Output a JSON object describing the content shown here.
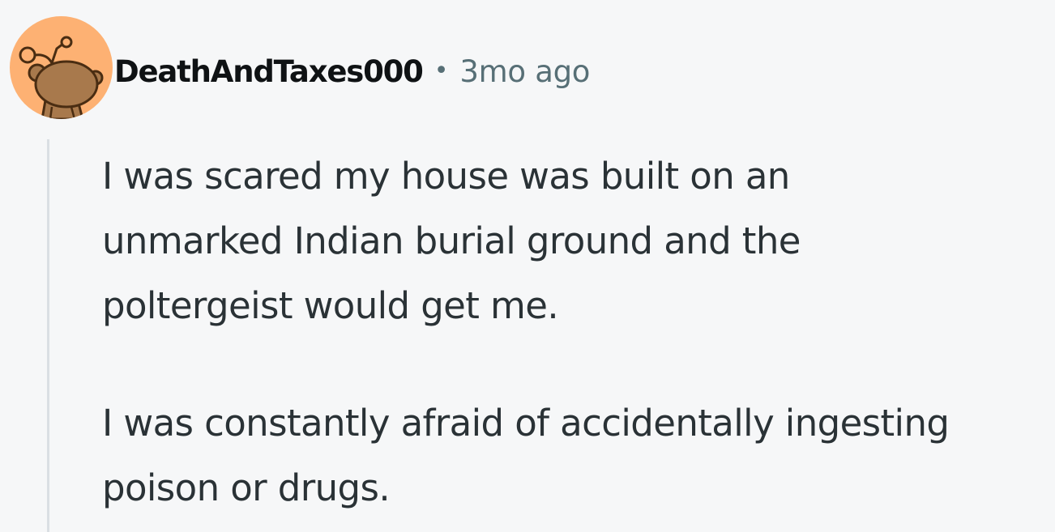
{
  "comment": {
    "author": "DeathAndTaxes000",
    "separator": "•",
    "timestamp": "3mo ago",
    "avatar_icon": "snoo-avatar-icon",
    "avatar_bg": "#fdb173",
    "paragraphs": [
      "I was scared my house was built on an\nunmarked Indian burial ground and the\npoltergeist would get me.",
      "I was constantly afraid of accidentally ingesting\npoison or drugs."
    ]
  },
  "colors": {
    "background": "#f6f7f8",
    "username": "#0f1214",
    "meta": "#576f76",
    "body_text": "#2a3236",
    "thread_line": "#dadfe3"
  }
}
